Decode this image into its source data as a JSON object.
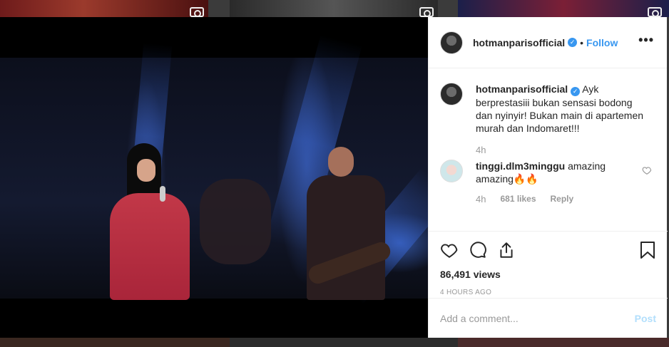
{
  "post": {
    "username": "hotmanparisofficial",
    "follow_label": "Follow",
    "separator": "•",
    "more_label": "•••",
    "caption_text": "Ayk berprestasiii bukan sensasi bodong dan nyinyir! Bukan main di apartemen murah dan Indomaret!!!",
    "caption_time": "4h",
    "views": "86,491 views",
    "time_ago": "4 HOURS AGO"
  },
  "comments": [
    {
      "username": "tinggi.dlm3minggu",
      "text": "amazing amazing🔥🔥",
      "time": "4h",
      "likes": "681 likes",
      "reply": "Reply"
    }
  ],
  "composer": {
    "placeholder": "Add a comment...",
    "post_label": "Post"
  },
  "colors": {
    "accent": "#3897f0",
    "post_disabled": "#b2dffc",
    "muted": "#999999"
  },
  "icons": [
    "heart-icon",
    "comment-icon",
    "share-icon",
    "bookmark-icon",
    "verified-icon",
    "more-icon",
    "video-icon"
  ]
}
